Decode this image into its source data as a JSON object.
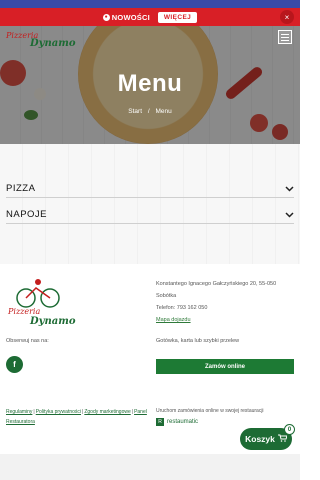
{
  "news_bar": {
    "label": "NOWOŚCI",
    "button": "WIĘCEJ",
    "close": "×"
  },
  "header": {
    "logo_line1": "Pizzeria",
    "logo_line2": "Dynamo"
  },
  "hero": {
    "title": "Menu",
    "breadcrumb": [
      "Start",
      "/",
      "Menu"
    ]
  },
  "categories": [
    {
      "label": "PIZZA"
    },
    {
      "label": "NAPOJE"
    }
  ],
  "footer": {
    "logo_line1": "Pizzeria",
    "logo_line2": "Dynamo",
    "address_line1": "Konstantego Ignacego Gałczyńskiego 20, 55-050",
    "address_line2": "Sobótka",
    "phone": "Telefon: 793 162 050",
    "map_link": "Mapa dojazdu",
    "follow_label": "Obserwuj nas na:",
    "facebook": "f",
    "payment": "Gotówka, karta lub szybki przelew",
    "order_button": "Zamów online",
    "legal_links": [
      "Regulaminy",
      "Polityka prywatności",
      "Zgody marketingowe",
      "Panel Restauratora"
    ],
    "restaurant_text": "Uruchom zamówienia online w swojej restauracji",
    "restaumatic": "restaumatic"
  },
  "cart": {
    "label": "Koszyk",
    "count": "0"
  },
  "colors": {
    "accent": "#d81f26",
    "brand": "#1d6b34",
    "news_top": "#3a4aa8"
  }
}
